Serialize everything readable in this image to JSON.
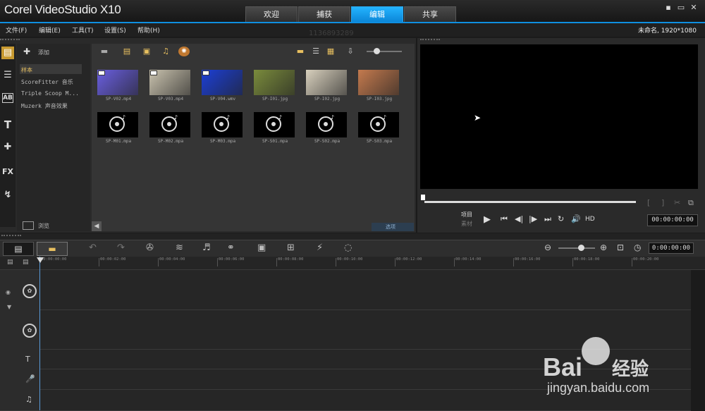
{
  "app": {
    "brand": "Corel VideoStudio X10"
  },
  "tabs": [
    {
      "label": "欢迎",
      "active": false
    },
    {
      "label": "捕获",
      "active": false
    },
    {
      "label": "编辑",
      "active": true
    },
    {
      "label": "共享",
      "active": false
    }
  ],
  "window_buttons": [
    "▪",
    "▭",
    "✕"
  ],
  "menu": [
    "文件(F)",
    "编辑(E)",
    "工具(T)",
    "设置(S)",
    "帮助(H)"
  ],
  "project_info": "未命名, 1920*1080",
  "ghost_number": "1136893289",
  "library": {
    "add_label": "添加",
    "folders": [
      "样本",
      "ScoreFitter 音乐",
      "Triple Scoop M...",
      "Muzerk 声音效果"
    ],
    "browse_label": "浏览",
    "options_label": "选项",
    "media": [
      {
        "name": "SP-V02.mp4",
        "kind": "video",
        "color": "#6a5fe0"
      },
      {
        "name": "SP-V03.mp4",
        "kind": "video",
        "color": "#c9c2ae"
      },
      {
        "name": "SP-V04.wmv",
        "kind": "video",
        "color": "#1c3fd6"
      },
      {
        "name": "SP-I01.jpg",
        "kind": "image",
        "color": "#7a8b3c"
      },
      {
        "name": "SP-I02.jpg",
        "kind": "image",
        "color": "#d8d0bd"
      },
      {
        "name": "SP-I03.jpg",
        "kind": "image",
        "color": "#c47a4e"
      },
      {
        "name": "SP-M01.mpa",
        "kind": "audio"
      },
      {
        "name": "SP-M02.mpa",
        "kind": "audio"
      },
      {
        "name": "SP-M03.mpa",
        "kind": "audio"
      },
      {
        "name": "SP-S01.mpa",
        "kind": "audio"
      },
      {
        "name": "SP-S02.mpa",
        "kind": "audio"
      },
      {
        "name": "SP-S03.mpa",
        "kind": "audio"
      }
    ]
  },
  "preview": {
    "project_label": "项目",
    "clip_label": "素材",
    "hd_label": "HD",
    "timecode": "00:00:00:00"
  },
  "timeline": {
    "timecode": "0:00:00:00",
    "ticks": [
      "00:00:00:00",
      "00:00:02:00",
      "00:00:04:00",
      "00:00:06:00",
      "00:00:08:00",
      "00:00:10:00",
      "00:00:12:00",
      "00:00:14:00",
      "00:00:16:00",
      "00:00:18:00",
      "00:00:20:00"
    ]
  },
  "watermark": {
    "brand": "Bai",
    "brand2": "经验",
    "url": "jingyan.baidu.com"
  }
}
